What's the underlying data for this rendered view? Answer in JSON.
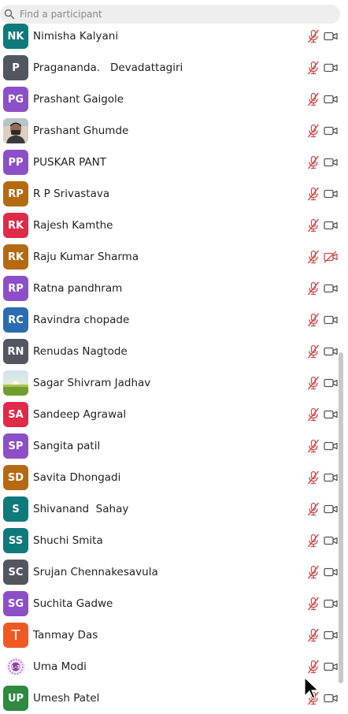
{
  "search": {
    "placeholder": "Find a participant",
    "value": ""
  },
  "colors": {
    "mic_muted": "#d24a4a",
    "camera_off": "#d24a4a",
    "camera_on": "#555555"
  },
  "participants": [
    {
      "initials": "NK",
      "name": "Nimisha Kalyani",
      "color": "#0f7a7a",
      "avatar": "initials",
      "mic": "muted",
      "camera": "on"
    },
    {
      "initials": "P",
      "name": "Pragananda.   Devadattagiri",
      "color": "#51565f",
      "avatar": "initials",
      "mic": "muted",
      "camera": "on"
    },
    {
      "initials": "PG",
      "name": "Prashant Gaigole",
      "color": "#8d4fc7",
      "avatar": "initials",
      "mic": "muted",
      "camera": "on"
    },
    {
      "initials": "",
      "name": "Prashant Ghumde",
      "color": "#c9b8a8",
      "avatar": "photo-person",
      "mic": "muted",
      "camera": "on"
    },
    {
      "initials": "PP",
      "name": "PUSKAR PANT",
      "color": "#8d4fc7",
      "avatar": "initials",
      "mic": "muted",
      "camera": "on"
    },
    {
      "initials": "RP",
      "name": "R P Srivastava",
      "color": "#b56a12",
      "avatar": "initials",
      "mic": "muted",
      "camera": "on"
    },
    {
      "initials": "RK",
      "name": "Rajesh Kamthe",
      "color": "#e02a4a",
      "avatar": "initials",
      "mic": "muted",
      "camera": "on"
    },
    {
      "initials": "RK",
      "name": "Raju Kumar Sharma",
      "color": "#b56a12",
      "avatar": "initials",
      "mic": "muted",
      "camera": "off"
    },
    {
      "initials": "RP",
      "name": "Ratna pandhram",
      "color": "#8d4fc7",
      "avatar": "initials",
      "mic": "muted",
      "camera": "on"
    },
    {
      "initials": "RC",
      "name": "Ravindra chopade",
      "color": "#2a6db0",
      "avatar": "initials",
      "mic": "muted",
      "camera": "on"
    },
    {
      "initials": "RN",
      "name": "Renudas Nagtode",
      "color": "#51565f",
      "avatar": "initials",
      "mic": "muted",
      "camera": "on"
    },
    {
      "initials": "",
      "name": "Sagar Shivram Jadhav",
      "color": "#8fb34a",
      "avatar": "photo-landscape",
      "mic": "muted",
      "camera": "on"
    },
    {
      "initials": "SA",
      "name": "Sandeep Agrawal",
      "color": "#e02a4a",
      "avatar": "initials",
      "mic": "muted",
      "camera": "on"
    },
    {
      "initials": "SP",
      "name": "Sangita patil",
      "color": "#8d4fc7",
      "avatar": "initials",
      "mic": "muted",
      "camera": "on"
    },
    {
      "initials": "SD",
      "name": "Savita Dhongadi",
      "color": "#b56a12",
      "avatar": "initials",
      "mic": "muted",
      "camera": "on"
    },
    {
      "initials": "S",
      "name": "Shivanand  Sahay",
      "color": "#0f7a7a",
      "avatar": "initials",
      "mic": "muted",
      "camera": "on"
    },
    {
      "initials": "SS",
      "name": "Shuchi Smita",
      "color": "#0f7a7a",
      "avatar": "initials",
      "mic": "muted",
      "camera": "on"
    },
    {
      "initials": "SC",
      "name": "Srujan Chennakesavula",
      "color": "#51565f",
      "avatar": "initials",
      "mic": "muted",
      "camera": "on"
    },
    {
      "initials": "SG",
      "name": "Suchita Gadwe",
      "color": "#8d4fc7",
      "avatar": "initials",
      "mic": "muted",
      "camera": "on"
    },
    {
      "initials": "T",
      "name": "Tanmay Das",
      "color": "#f05a22",
      "avatar": "initials",
      "mic": "muted",
      "camera": "on"
    },
    {
      "initials": "",
      "name": "Uma Modi",
      "color": "#f3e6f7",
      "avatar": "logo",
      "mic": "muted",
      "camera": "on"
    },
    {
      "initials": "UP",
      "name": "Umesh Patel",
      "color": "#2d8a3e",
      "avatar": "initials",
      "mic": "muted",
      "camera": "on"
    }
  ]
}
